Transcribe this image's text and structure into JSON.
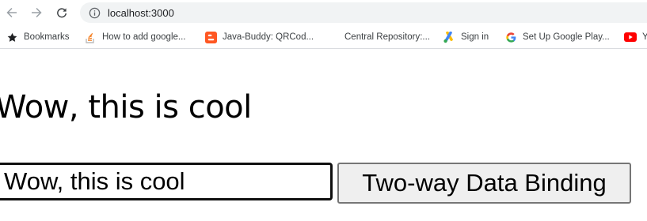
{
  "browser": {
    "url": "localhost:3000",
    "accent": "#1a73e8"
  },
  "toolbar": {
    "icons": [
      "back-arrow-icon",
      "forward-arrow-icon",
      "reload-icon",
      "info-icon"
    ]
  },
  "bookmarks": [
    {
      "label": "Bookmarks",
      "icon": "star-icon"
    },
    {
      "label": "How to add google...",
      "icon": "stack-overflow-icon"
    },
    {
      "label": "Java-Buddy: QRCod...",
      "icon": "blogger-icon"
    },
    {
      "label": "Central Repository:...",
      "icon": "blank-page-icon"
    },
    {
      "label": "Sign in",
      "icon": "google-ads-icon"
    },
    {
      "label": "Set Up Google Play...",
      "icon": "google-g-icon"
    },
    {
      "label": "Y",
      "icon": "youtube-icon"
    }
  ],
  "page": {
    "heading": "Wow, this is cool",
    "input_value": "Wow, this is cool",
    "button_label": "Two-way Data Binding"
  }
}
